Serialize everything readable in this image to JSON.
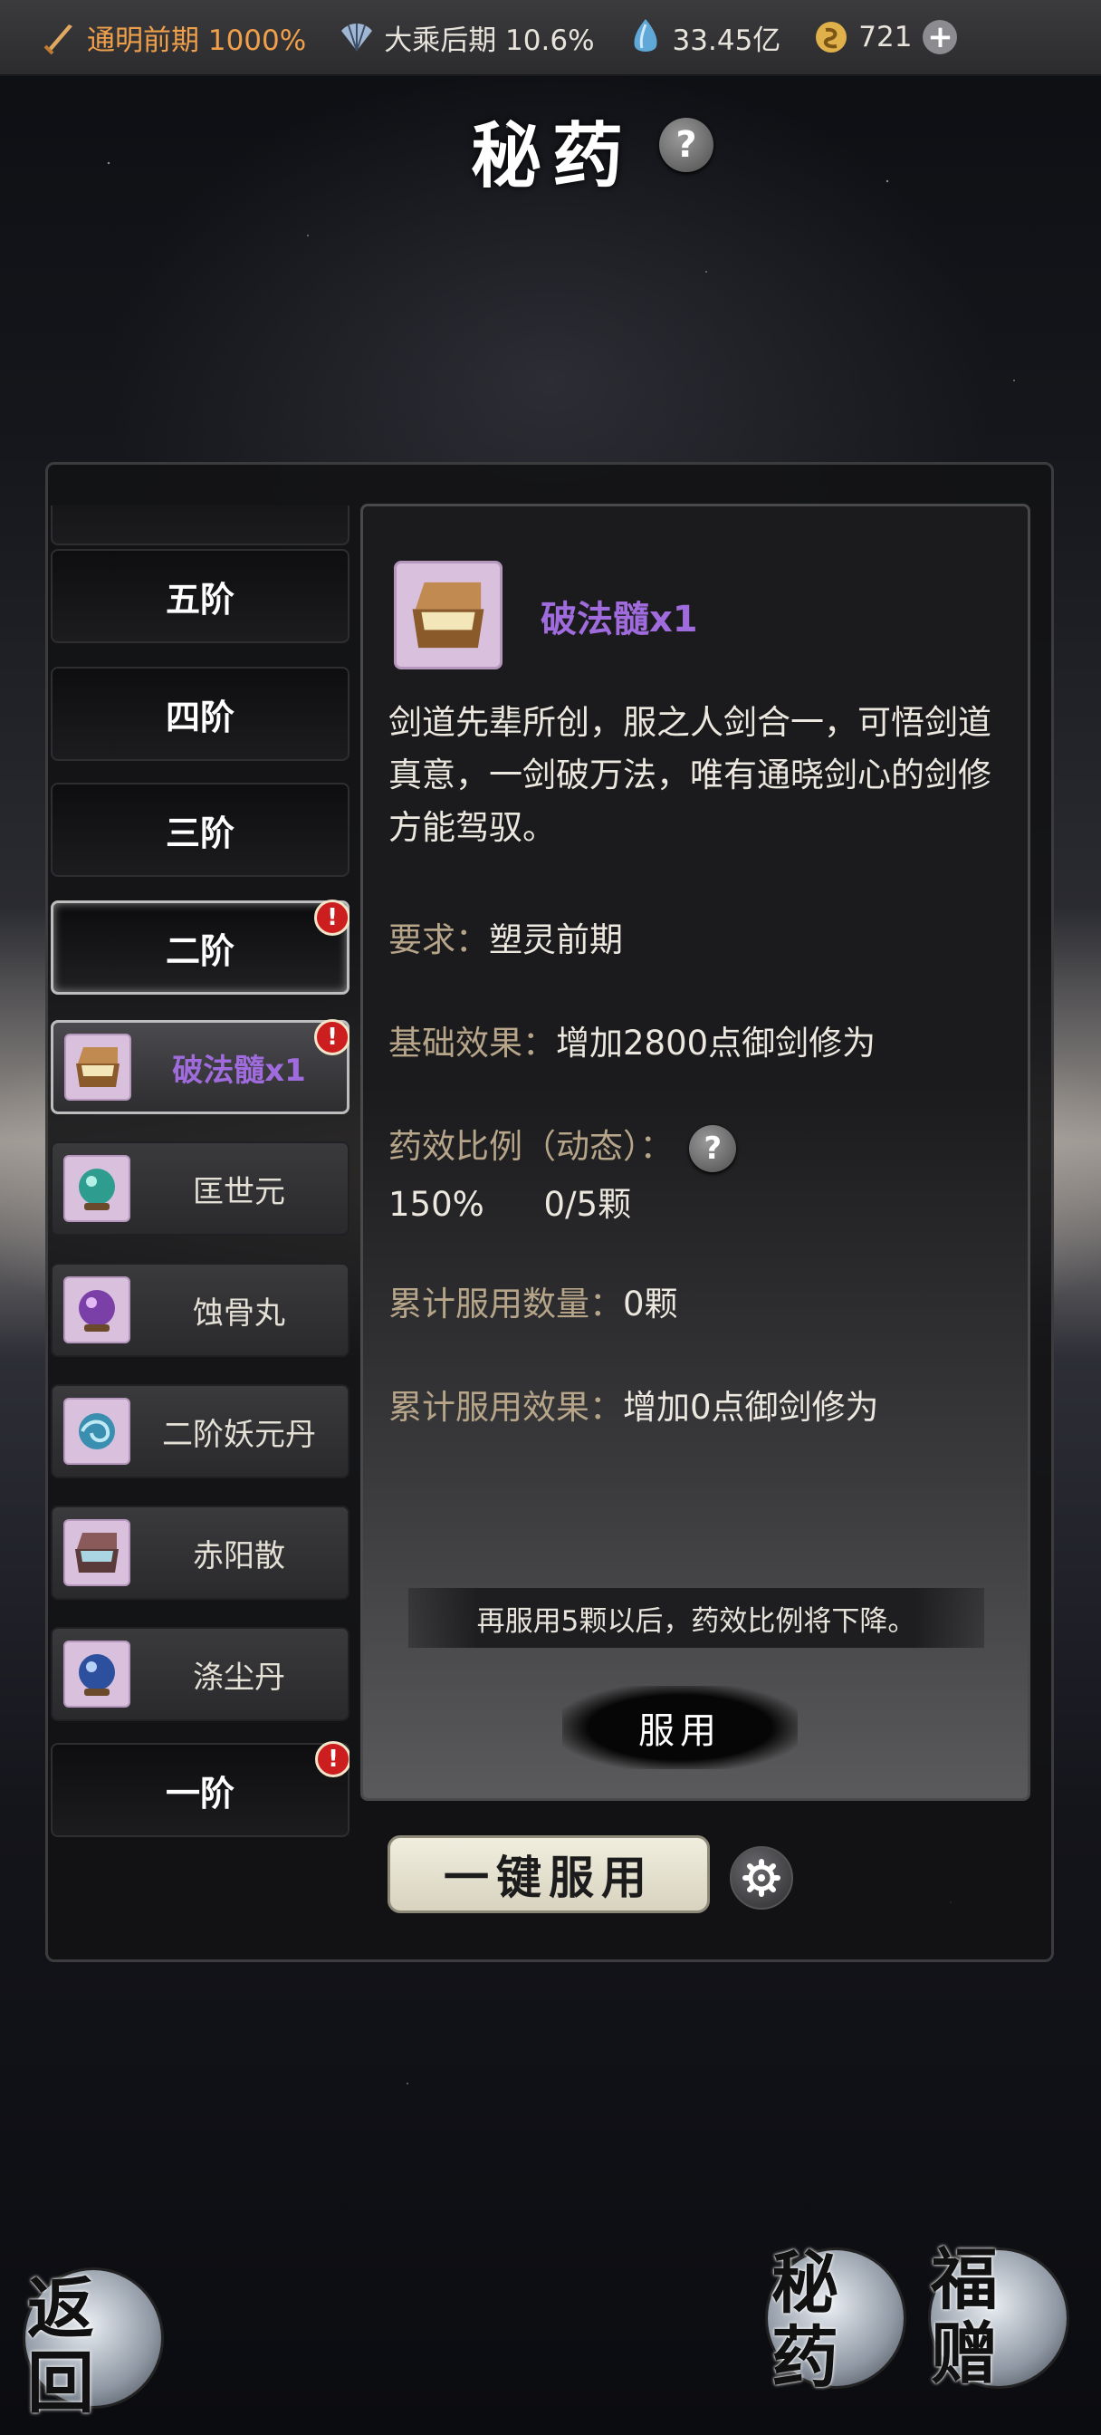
{
  "topbar": {
    "realm": {
      "label": "通明前期 1000%",
      "icon": "sword-icon",
      "color": "#f0a04b"
    },
    "stage": {
      "label": "大乘后期 10.6%",
      "icon": "fan-icon"
    },
    "spirit_stones": {
      "label": "33.45亿",
      "icon": "crystal-icon"
    },
    "gold": {
      "label": "721",
      "icon": "coin-icon"
    },
    "plus": "+"
  },
  "page": {
    "title": "秘药",
    "help": "?"
  },
  "left_list": {
    "tiers": [
      {
        "label": "五阶"
      },
      {
        "label": "四阶"
      },
      {
        "label": "三阶"
      },
      {
        "label": "二阶",
        "badge": "!"
      },
      {
        "label": "一阶",
        "badge": "!"
      }
    ],
    "medicines": [
      {
        "name": "破法髓x1",
        "badge": "!",
        "icon": "chest-icon",
        "selected": true
      },
      {
        "name": "匡世元",
        "icon": "teal-orb-icon"
      },
      {
        "name": "蚀骨丸",
        "icon": "purple-orb-icon"
      },
      {
        "name": "二阶妖元丹",
        "icon": "swirl-orb-icon"
      },
      {
        "name": "赤阳散",
        "icon": "chest-icon"
      },
      {
        "name": "涤尘丹",
        "icon": "blue-orb-icon"
      }
    ]
  },
  "detail": {
    "name": "破法髓x1",
    "description": "剑道先辈所创，服之人剑合一，可悟剑道真意，一剑破万法，唯有通晓剑心的剑修方能驾驭。",
    "requirement_label": "要求：",
    "requirement_value": "塑灵前期",
    "base_effect_label": "基础效果：",
    "base_effect_value": "增加2800点御剑修为",
    "ratio_label": "药效比例（动态）：",
    "ratio_value": "150%",
    "ratio_count": "0/5颗",
    "total_count_label": "累计服用数量：",
    "total_count_value": "0颗",
    "total_effect_label": "累计服用效果：",
    "total_effect_value": "增加0点御剑修为",
    "notice": "再服用5颗以后，药效比例将下降。",
    "use_button": "服用"
  },
  "onekey_button": "一键服用",
  "bottom": {
    "back": "返回",
    "secret_medicine": "秘药",
    "gift": "福赠"
  }
}
